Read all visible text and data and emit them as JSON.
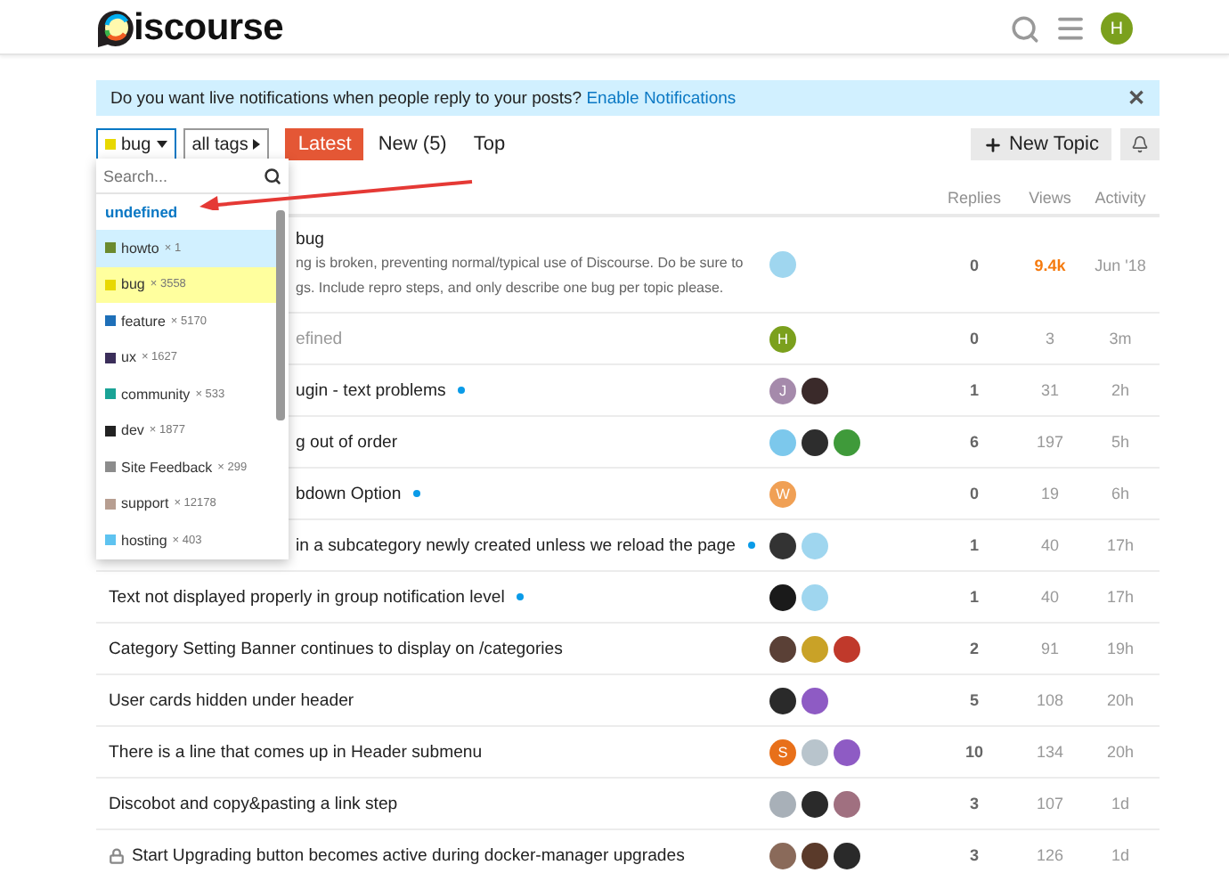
{
  "header": {
    "logo_text": "iscourse",
    "user_avatar": {
      "letter": "H",
      "color": "#7ba01d"
    }
  },
  "banner": {
    "text": "Do you want live notifications when people reply to your posts?",
    "link": "Enable Notifications",
    "close": "✕"
  },
  "nav": {
    "category": {
      "label": "bug",
      "color": "#e8d800"
    },
    "tags": {
      "label": "all tags"
    },
    "tabs": [
      {
        "label": "Latest",
        "selected": true
      },
      {
        "label": "New (5)",
        "selected": false
      },
      {
        "label": "Top",
        "selected": false
      }
    ],
    "new_topic": "New Topic"
  },
  "dropdown": {
    "placeholder": "Search...",
    "none_label": "undefined",
    "items": [
      {
        "name": "howto",
        "count": "× 1",
        "color": "#6b8a2e",
        "highlighted": true,
        "selected": false
      },
      {
        "name": "bug",
        "count": "× 3558",
        "color": "#e8d800",
        "highlighted": false,
        "selected": true
      },
      {
        "name": "feature",
        "count": "× 5170",
        "color": "#1e6fb8",
        "highlighted": false,
        "selected": false
      },
      {
        "name": "ux",
        "count": "× 1627",
        "color": "#3b2e5a",
        "highlighted": false,
        "selected": false
      },
      {
        "name": "community",
        "count": "× 533",
        "color": "#1aa396",
        "highlighted": false,
        "selected": false
      },
      {
        "name": "dev",
        "count": "× 1877",
        "color": "#222222",
        "highlighted": false,
        "selected": false
      },
      {
        "name": "Site Feedback",
        "count": "× 299",
        "color": "#8c8c8c",
        "highlighted": false,
        "selected": false
      },
      {
        "name": "support",
        "count": "× 12178",
        "color": "#b79e91",
        "highlighted": false,
        "selected": false
      },
      {
        "name": "hosting",
        "count": "× 403",
        "color": "#5ec3f0",
        "highlighted": false,
        "selected": false
      }
    ]
  },
  "table": {
    "columns": [
      "Replies",
      "Views",
      "Activity"
    ],
    "rows": [
      {
        "title": "bug",
        "excerpt": [
          "ng is broken, preventing normal/typical use of Discourse. Do be sure to",
          "gs. Include repro steps, and only describe one bug per topic please."
        ],
        "faded": false,
        "unread": false,
        "locked": false,
        "hot": true,
        "posters": [
          {
            "color": "#9fd6ef"
          }
        ],
        "replies": "0",
        "views": "9.4k",
        "activity": "Jun '18"
      },
      {
        "title": "efined",
        "faded": true,
        "unread": false,
        "locked": false,
        "hot": false,
        "posters": [
          {
            "color": "#7ba01d",
            "letter": "H"
          }
        ],
        "replies": "0",
        "views": "3",
        "activity": "3m"
      },
      {
        "title": "ugin - text problems",
        "faded": false,
        "unread": true,
        "locked": false,
        "hot": false,
        "posters": [
          {
            "color": "#a58aab",
            "letter": "J"
          },
          {
            "color": "#3a2a2a"
          }
        ],
        "replies": "1",
        "views": "31",
        "activity": "2h"
      },
      {
        "title": "g out of order",
        "faded": false,
        "unread": false,
        "locked": false,
        "hot": false,
        "posters": [
          {
            "color": "#7cc8ec"
          },
          {
            "color": "#2d2d2d"
          },
          {
            "color": "#3f9a3a"
          }
        ],
        "replies": "6",
        "views": "197",
        "activity": "5h"
      },
      {
        "title": "bdown Option",
        "faded": false,
        "unread": true,
        "locked": false,
        "hot": false,
        "posters": [
          {
            "color": "#f0a055",
            "letter": "W"
          }
        ],
        "replies": "0",
        "views": "19",
        "activity": "6h"
      },
      {
        "title": "in a subcategory newly created unless we reload the page",
        "faded": false,
        "unread": true,
        "locked": false,
        "hot": false,
        "posters": [
          {
            "color": "#333333"
          },
          {
            "color": "#9fd6ef"
          }
        ],
        "replies": "1",
        "views": "40",
        "activity": "17h"
      },
      {
        "title": "Text not displayed properly in group notification level",
        "faded": false,
        "unread": true,
        "locked": false,
        "hot": false,
        "posters": [
          {
            "color": "#1a1a1a"
          },
          {
            "color": "#9fd6ef"
          }
        ],
        "replies": "1",
        "views": "40",
        "activity": "17h"
      },
      {
        "title": "Category Setting Banner continues to display on /categories",
        "faded": false,
        "unread": false,
        "locked": false,
        "hot": false,
        "posters": [
          {
            "color": "#5a4036"
          },
          {
            "color": "#c9a227"
          },
          {
            "color": "#c0392b"
          }
        ],
        "replies": "2",
        "views": "91",
        "activity": "19h"
      },
      {
        "title": "User cards hidden under header",
        "faded": false,
        "unread": false,
        "locked": false,
        "hot": false,
        "posters": [
          {
            "color": "#2a2a2a"
          },
          {
            "color": "#8e5bc4"
          }
        ],
        "replies": "5",
        "views": "108",
        "activity": "20h"
      },
      {
        "title": "There is a line that comes up in Header submenu",
        "faded": false,
        "unread": false,
        "locked": false,
        "hot": false,
        "posters": [
          {
            "color": "#e8701a",
            "letter": "S"
          },
          {
            "color": "#b8c4cc"
          },
          {
            "color": "#8e5bc4"
          }
        ],
        "replies": "10",
        "views": "134",
        "activity": "20h"
      },
      {
        "title": "Discobot and copy&pasting a link step",
        "faded": false,
        "unread": false,
        "locked": false,
        "hot": false,
        "posters": [
          {
            "color": "#a8b0b8"
          },
          {
            "color": "#2a2a2a"
          },
          {
            "color": "#a07080"
          }
        ],
        "replies": "3",
        "views": "107",
        "activity": "1d"
      },
      {
        "title": "Start Upgrading button becomes active during docker-manager upgrades",
        "faded": false,
        "unread": false,
        "locked": true,
        "hot": false,
        "posters": [
          {
            "color": "#8a6a5a"
          },
          {
            "color": "#5a3a2a"
          },
          {
            "color": "#2a2a2a"
          }
        ],
        "replies": "3",
        "views": "126",
        "activity": "1d"
      }
    ]
  }
}
